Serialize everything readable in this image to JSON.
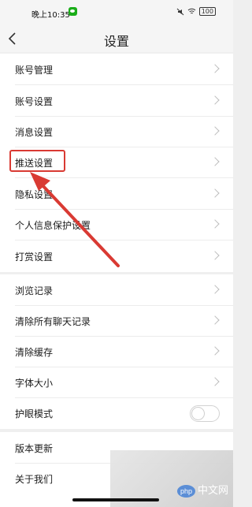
{
  "status_bar": {
    "time": "晚上10:35",
    "battery": "100"
  },
  "header": {
    "title": "设置"
  },
  "groups": [
    {
      "items": [
        {
          "label": "账号管理"
        },
        {
          "label": "账号设置"
        },
        {
          "label": "消息设置"
        },
        {
          "label": "推送设置"
        },
        {
          "label": "隐私设置"
        },
        {
          "label": "个人信息保护设置"
        },
        {
          "label": "打赏设置"
        }
      ]
    },
    {
      "items": [
        {
          "label": "浏览记录"
        },
        {
          "label": "清除所有聊天记录"
        },
        {
          "label": "清除缓存"
        },
        {
          "label": "字体大小"
        },
        {
          "label": "护眼模式",
          "toggle": "off"
        }
      ]
    },
    {
      "items": [
        {
          "label": "版本更新"
        },
        {
          "label": "关于我们"
        }
      ]
    }
  ],
  "watermark": {
    "badge": "php",
    "text": "中文网"
  },
  "colors": {
    "highlight": "#d93a33",
    "background": "#efefef"
  }
}
